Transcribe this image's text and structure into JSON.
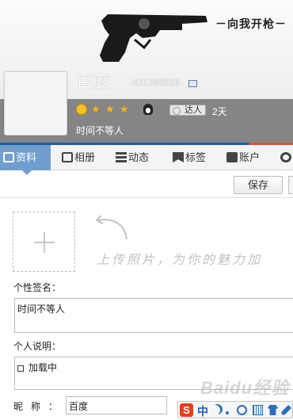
{
  "banner": {
    "slogan": "－向我开枪－"
  },
  "profile": {
    "name": "百度",
    "qq_number": "431388556",
    "stars": [
      "★",
      "★",
      "★"
    ],
    "badge_label": "达人",
    "days": "2天",
    "motto": "时间不等人"
  },
  "tabs": [
    {
      "label": "资料",
      "icon": "id-card-icon",
      "active": true
    },
    {
      "label": "相册",
      "icon": "photo-icon"
    },
    {
      "label": "动态",
      "icon": "list-icon"
    },
    {
      "label": "标签",
      "icon": "bookmark-icon"
    },
    {
      "label": "账户",
      "icon": "briefcase-icon"
    }
  ],
  "toolbar": {
    "save_label": "保存"
  },
  "upload": {
    "hint": "上传照片，为你的魅力加"
  },
  "form": {
    "signature_label": "个性签名：",
    "signature_value": "时间不等人",
    "description_label": "个人说明：",
    "description_value": "加载中",
    "nickname_label": "昵称：",
    "nickname_value": "百度"
  },
  "ime": {
    "logo": "S",
    "mode": "中"
  },
  "watermark": "Baidu经验",
  "colors": {
    "tab_active": "#6f9ecf",
    "band": "#858585",
    "accent_line": "#1c5fa7"
  }
}
